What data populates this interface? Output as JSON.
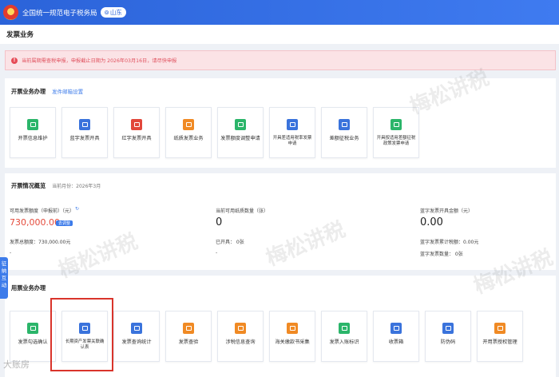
{
  "header": {
    "portal_title": "全国统一规范电子税务局",
    "region": "山东",
    "region_icon": "location-pin-icon"
  },
  "breadcrumb": {
    "title": "发票业务"
  },
  "alert": {
    "icon": "alert-icon",
    "text": "当前属期需查税申报，申报截止日期为 2026年03月16日，请尽快申报"
  },
  "section_issue": {
    "title": "开票业务办理",
    "link": "发件邮箱设置",
    "tiles": [
      {
        "label": "开票信息维护",
        "color": "#2bb56a"
      },
      {
        "label": "蓝字发票开具",
        "color": "#3a73dc"
      },
      {
        "label": "红字发票开具",
        "color": "#e2473b"
      },
      {
        "label": "纸质发票业务",
        "color": "#f08a24"
      },
      {
        "label": "发票额度调整申请",
        "color": "#2bb56a"
      },
      {
        "label": "开具差适用税率发票申请",
        "color": "#3a73dc"
      },
      {
        "label": "差额征税业务",
        "color": "#3a73dc"
      },
      {
        "label": "开具按适用差额征税政策发票申请",
        "color": "#2bb56a"
      }
    ]
  },
  "section_overview": {
    "title": "开票情况概览",
    "period": "当前月份：2026年3月",
    "col1": {
      "label": "可用发票额度（申报前）（元）",
      "value": "730,000.00",
      "badge": "去调整",
      "total": "发票总额度：730,000.00元",
      "dash": "-"
    },
    "col2": {
      "label": "当前可用纸质数量（张）",
      "value": "0",
      "issued": "已开具： 0张",
      "dash": "-"
    },
    "col3": {
      "label": "蓝字发票开具金额（元）",
      "value": "0.00",
      "tax_total": "蓝字发票累计税额：0.00元",
      "count": "蓝字发票数量： 0张"
    }
  },
  "side_tab": {
    "label": "征纳互动"
  },
  "section_receive": {
    "title": "用票业务办理",
    "tiles": [
      {
        "label": "发票勾选确认",
        "color": "#2bb56a"
      },
      {
        "label": "长期资产发票关联确认表",
        "color": "#3a73dc"
      },
      {
        "label": "发票查询统计",
        "color": "#3a73dc"
      },
      {
        "label": "发票查验",
        "color": "#f08a24"
      },
      {
        "label": "涉税信息查询",
        "color": "#f08a24"
      },
      {
        "label": "海关缴款书采集",
        "color": "#f08a24"
      },
      {
        "label": "发票入账标识",
        "color": "#2bb56a"
      },
      {
        "label": "收票箱",
        "color": "#3a73dc"
      },
      {
        "label": "防伪码",
        "color": "#3a73dc"
      },
      {
        "label": "开用票授权管理",
        "color": "#f08a24"
      }
    ]
  },
  "watermarks": {
    "main": "梅松讲税",
    "corner": "大账房"
  }
}
